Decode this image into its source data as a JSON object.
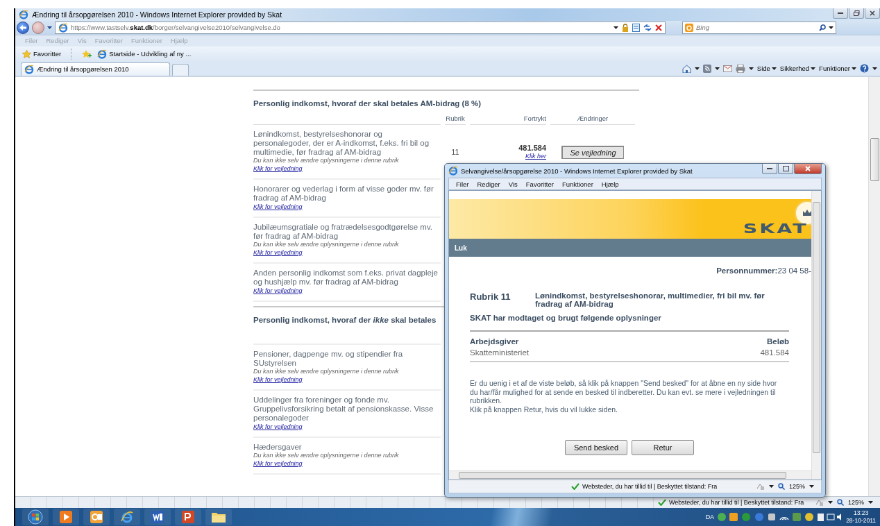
{
  "window": {
    "title": "Ændring til årsopgørelsen 2010 - Windows Internet Explorer provided by Skat"
  },
  "address_bar": {
    "url": "https://www.tastselv.**skat.dk**/borger/selvangivelse2010/selvangivelse.do"
  },
  "search": {
    "placeholder": "Bing"
  },
  "menu": [
    {
      "label": "Filer",
      "disabled": true
    },
    {
      "label": "Rediger",
      "disabled": true
    },
    {
      "label": "Vis",
      "disabled": true
    },
    {
      "label": "Favoritter",
      "disabled": true
    },
    {
      "label": "Funktioner",
      "disabled": true
    },
    {
      "label": "Hjælp",
      "disabled": true
    }
  ],
  "favorites_bar": {
    "favorites": "Favoritter",
    "links": [
      "Startside - Udvikling af ny ..."
    ]
  },
  "tabs": [
    {
      "label": "Ændring til årsopgørelsen 2010",
      "selected": true
    }
  ],
  "command_bar": [
    "Side",
    "Sikkerhed",
    "Funktioner"
  ],
  "page": {
    "sections": [
      {
        "title": "Personlig indkomst, hvoraf der skal betales AM-bidrag (8 %)",
        "columns": [
          "Rubrik",
          "Fortrykt",
          "Ændringer"
        ],
        "rows": [
          {
            "text": "Lønindkomst, bestyrelseshonorar og personalegoder, der er A-indkomst, f.eks. fri bil og multimedie, før fradrag af AM-bidrag",
            "note": "Du kan ikke selv ændre oplysningerne i denne rubrik",
            "link": "Klik for vejledning",
            "rubrik": "11",
            "value": "481.584",
            "value_link": "Klik her",
            "action": "Se vejledning"
          },
          {
            "text": "Honorarer og vederlag i form af visse goder mv. før fradrag af AM-bidrag",
            "link": "Klik for vejledning"
          },
          {
            "text": "Jubilæumsgratiale og fratrædelsesgodtgørelse mv. før fradrag af AM-bidrag",
            "note": "Du kan ikke selv ændre oplysningerne i denne rubrik",
            "link": "Klik for vejledning"
          },
          {
            "text": "Anden personlig indkomst som f.eks. privat dagpleje og hushjælp mv. før fradrag af AM-bidrag",
            "link": "Klik for vejledning"
          }
        ]
      },
      {
        "title": "Personlig indkomst, hvoraf der *ikke* skal betales",
        "rows": [
          {
            "text": "Pensioner, dagpenge mv. og stipendier fra SUstyrelsen",
            "note": "Du kan ikke selv ændre oplysningerne i denne rubrik",
            "link": "Klik for vejledning"
          },
          {
            "text": "Uddelinger fra foreninger og fonde mv. Gruppelivsforsikring betalt af pensionskasse. Visse personalegoder",
            "link": "Klik for vejledning"
          },
          {
            "text": "Hædersgaver",
            "note": "Du kan ikke selv ændre oplysningerne i denne rubrik",
            "link": "Klik for vejledning"
          }
        ]
      }
    ]
  },
  "popup": {
    "title": "Selvangivelse/årsopgørelse 2010 - Windows Internet Explorer provided by Skat",
    "menu": [
      {
        "label": "Filer",
        "disabled": false
      },
      {
        "label": "Rediger",
        "disabled": false
      },
      {
        "label": "Vis",
        "disabled": false
      },
      {
        "label": "Favoritter",
        "disabled": false
      },
      {
        "label": "Funktioner",
        "disabled": false
      },
      {
        "label": "Hjælp",
        "disabled": false
      }
    ],
    "logo": "SKAT",
    "nav": "Luk",
    "person_label": "Personnummer:",
    "person_value": "23 04 58-",
    "rubrik": "Rubrik 11",
    "rubrik_text": "Lønindkomst, bestyrelseshonorar, multimedier, fri bil mv. før fradrag af AM-bidrag",
    "subheading": "SKAT har modtaget og brugt følgende oplysninger",
    "columns": [
      "Arbejdsgiver",
      "Beløb"
    ],
    "rows": [
      [
        "Skatteministeriet",
        "481.584"
      ]
    ],
    "paragraphs": [
      "Er du uenig i et af de viste beløb, så klik på knappen \"Send besked\" for at åbne en ny side hvor du har/får mulighed for at sende en besked til indberetter. Du kan evt. se mere i vejledningen til rubrikken.",
      "Klik på knappen Retur, hvis du vil lukke siden."
    ],
    "buttons": [
      "Send besked",
      "Retur"
    ],
    "status_bar": {
      "text": "Websteder, du har tillid til | Beskyttet tilstand: Fra",
      "zoom": "125%"
    }
  },
  "status_bar": {
    "text": "Websteder, du har tillid til | Beskyttet tilstand: Fra",
    "zoom": "125%"
  },
  "taskbar": {
    "language": "DA",
    "time": "13:23",
    "date": "28-10-2011"
  }
}
